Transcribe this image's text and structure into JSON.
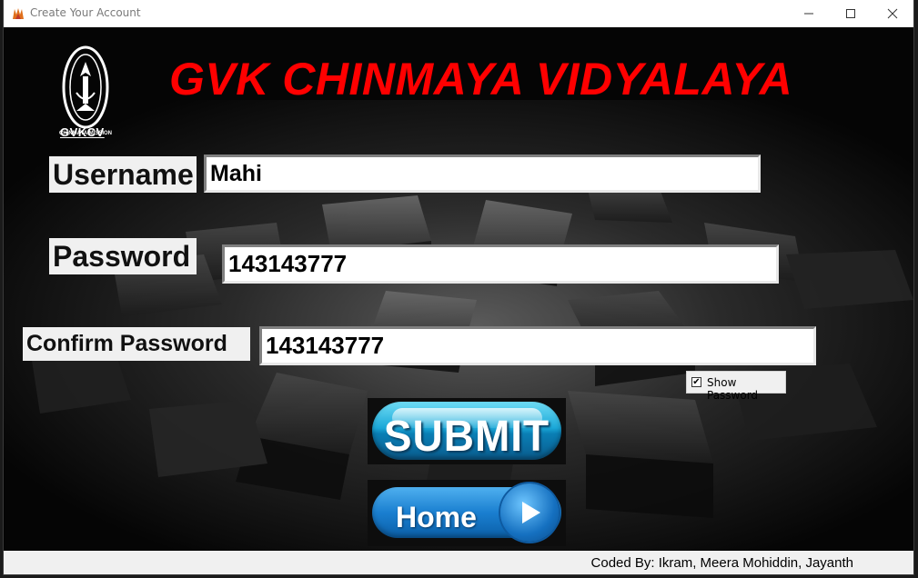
{
  "window": {
    "title": "Create Your Account"
  },
  "header": {
    "logo_text": "GVKCV",
    "school_name": "GVK CHINMAYA VIDYALAYA"
  },
  "form": {
    "username_label": "Username",
    "username_value": "Mahi",
    "password_label": "Password",
    "password_value": "143143777",
    "confirm_label": "Confirm Password",
    "confirm_value": "143143777",
    "show_password_label": "Show Password",
    "show_password_checked": true
  },
  "buttons": {
    "submit_label": "SUBMIT",
    "home_label": "Home"
  },
  "footer": {
    "credits": "Coded By: Ikram, Meera Mohiddin, Jayanth"
  },
  "colors": {
    "title_red": "#ff0000",
    "background": "#050505",
    "label_bg": "#f0f0f0"
  }
}
